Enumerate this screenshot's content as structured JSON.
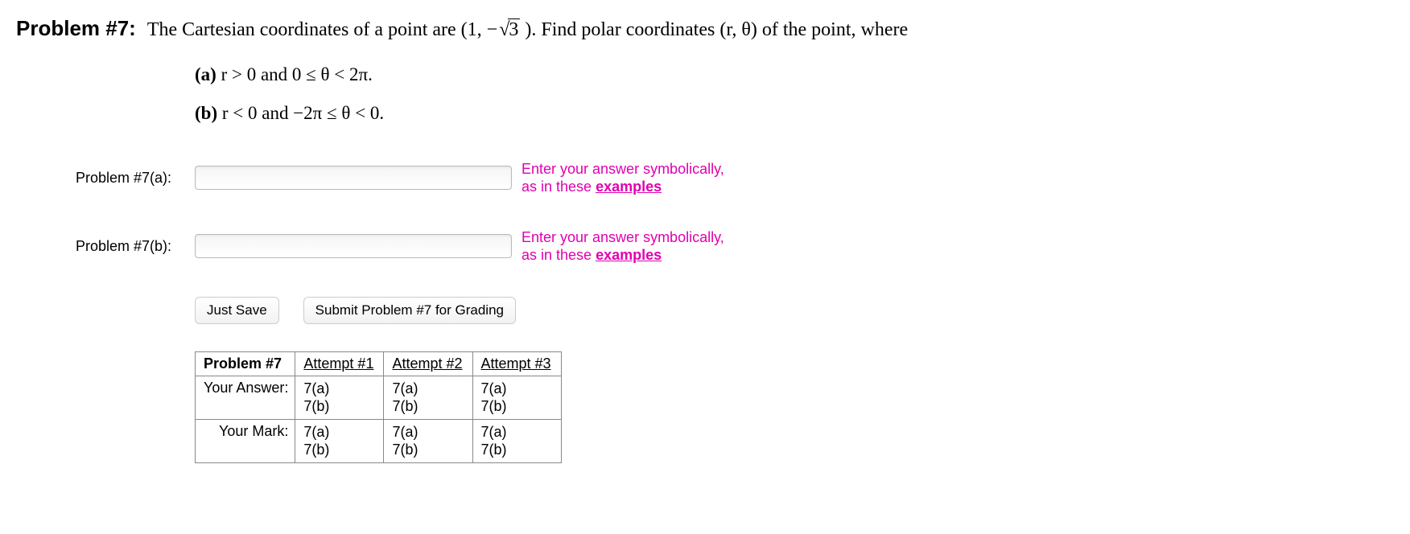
{
  "problem": {
    "number_label": "Problem #7:",
    "statement_pre": "The Cartesian coordinates of a point are (1, −",
    "sqrt_radicand": "3",
    "statement_post": " ). Find polar coordinates (r, θ) of the point, where",
    "parts": {
      "a": {
        "label": "(a)",
        "text": "r > 0  and  0 ≤ θ < 2π."
      },
      "b": {
        "label": "(b)",
        "text": "r < 0  and  −2π ≤ θ < 0."
      }
    }
  },
  "answers": {
    "a": {
      "label": "Problem #7(a):"
    },
    "b": {
      "label": "Problem #7(b):"
    }
  },
  "hint": {
    "line1": "Enter your answer symbolically,",
    "line2_pre": "as in these ",
    "link": "examples"
  },
  "buttons": {
    "save": "Just Save",
    "submit": "Submit Problem #7 for Grading"
  },
  "table": {
    "corner": "Problem #7",
    "attempts": [
      "Attempt #1",
      "Attempt #2",
      "Attempt #3"
    ],
    "row_answer_label": "Your Answer:",
    "row_mark_label": "Your Mark:",
    "subparts": [
      "7(a)",
      "7(b)"
    ]
  }
}
